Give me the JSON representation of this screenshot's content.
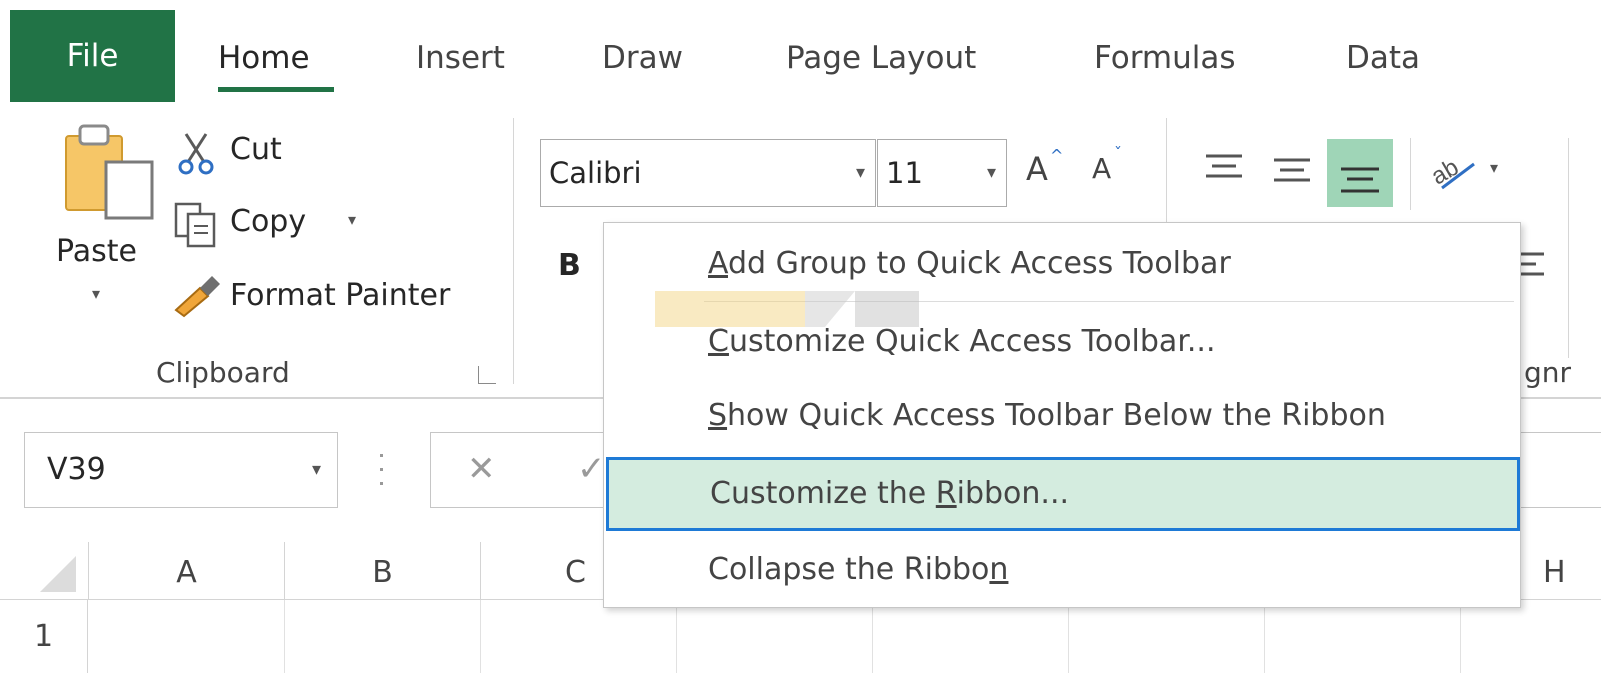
{
  "tabs": {
    "file": "File",
    "home": "Home",
    "insert": "Insert",
    "draw": "Draw",
    "page_layout": "Page Layout",
    "formulas": "Formulas",
    "data": "Data"
  },
  "clipboard": {
    "paste": "Paste",
    "cut": "Cut",
    "copy": "Copy",
    "format_painter": "Format Painter",
    "group_label": "Clipboard"
  },
  "font": {
    "name": "Calibri",
    "size": "11",
    "bold": "B"
  },
  "alignment": {
    "group_label_partial": "gnr"
  },
  "formula_bar": {
    "name_box": "V39"
  },
  "grid": {
    "columns": [
      "A",
      "B",
      "C",
      "H"
    ],
    "rows": [
      "1"
    ]
  },
  "context_menu": {
    "items": [
      {
        "pre": "",
        "acc": "A",
        "post": "dd Group to Quick Access Toolbar"
      },
      {
        "pre": "",
        "acc": "C",
        "post": "ustomize Quick Access Toolbar..."
      },
      {
        "pre": "",
        "acc": "S",
        "post": "how Quick Access Toolbar Below the Ribbon"
      },
      {
        "pre": "Customize the ",
        "acc": "R",
        "post": "ibbon..."
      },
      {
        "pre": "Collapse the Ribbo",
        "acc": "n",
        "post": ""
      }
    ],
    "selected_index": 3
  },
  "colors": {
    "excel_green": "#217346",
    "selection_fill": "#d4ecdf",
    "selection_border": "#1e7ad6",
    "align_highlight": "#9fd5b7"
  }
}
